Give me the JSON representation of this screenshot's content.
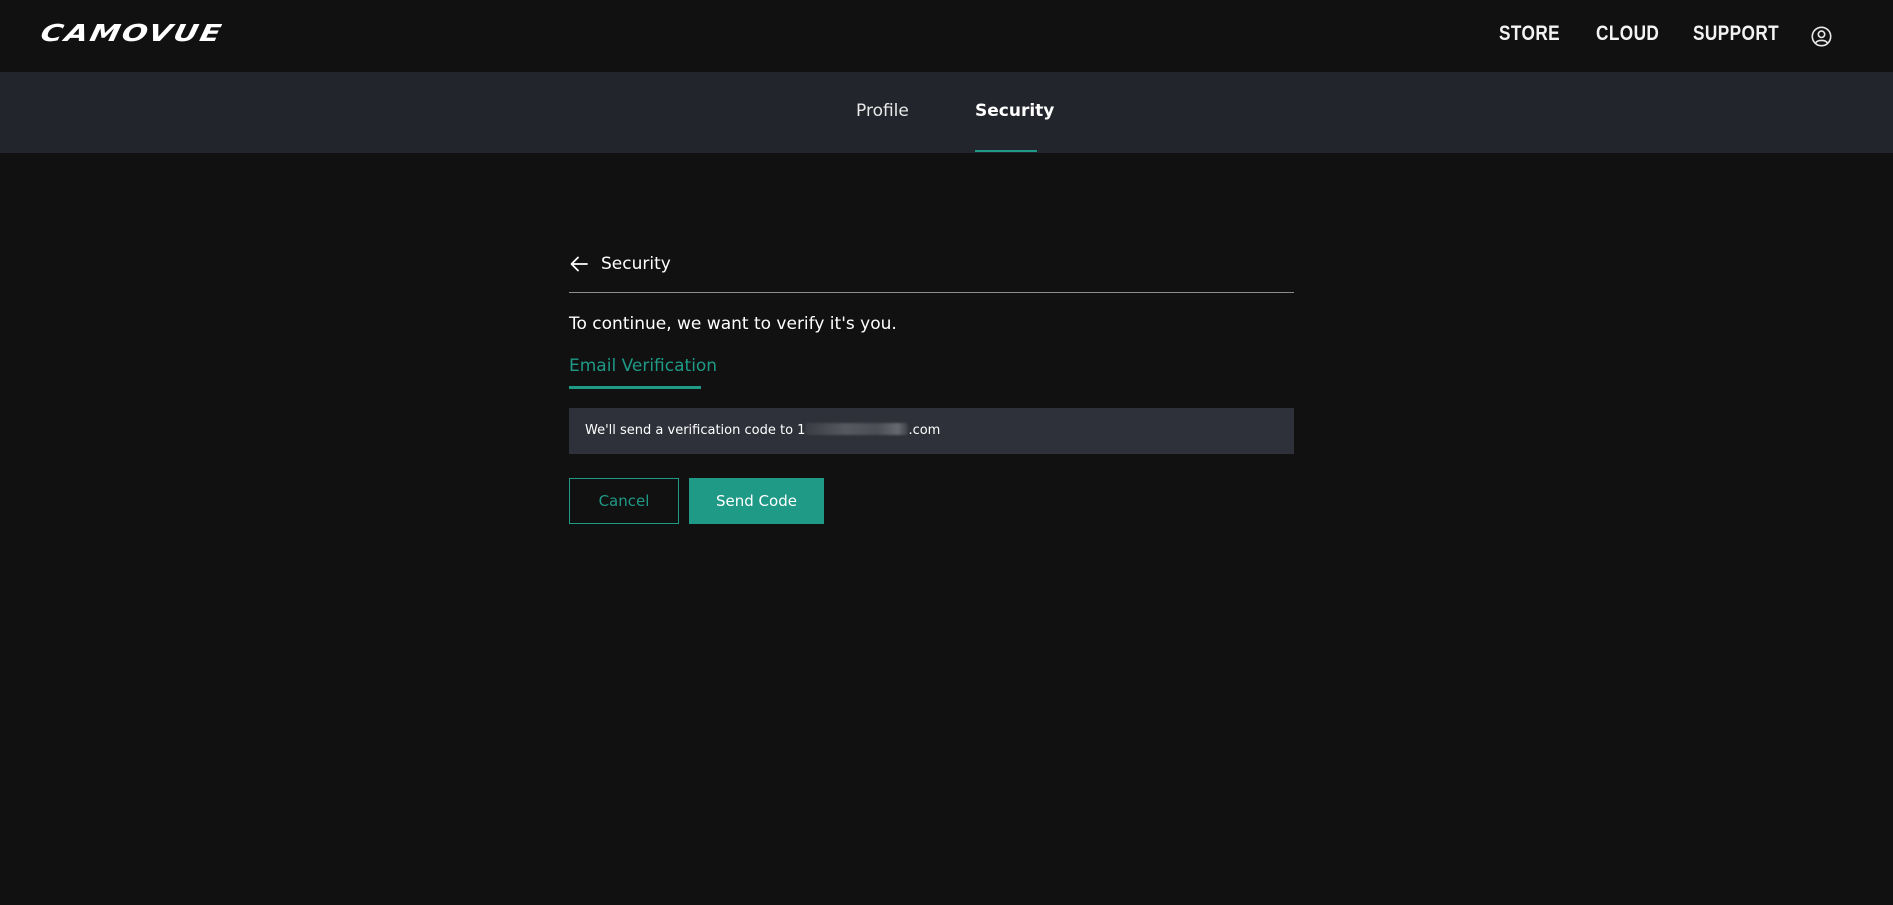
{
  "header": {
    "logo_text": "CAMOVUE",
    "nav": {
      "store": "STORE",
      "cloud": "CLOUD",
      "support": "SUPPORT"
    },
    "user_icon": "user-circle-icon"
  },
  "tabs": {
    "profile": "Profile",
    "security": "Security",
    "active": "Security"
  },
  "page": {
    "back_icon": "arrow-left-icon",
    "title": "Security",
    "prompt": "To continue, we want to verify it's you.",
    "method_tab": "Email Verification",
    "info_prefix": "We'll send a verification code to 1",
    "info_suffix": ".com",
    "cancel_label": "Cancel",
    "send_label": "Send Code"
  },
  "colors": {
    "accent": "#1e9a86",
    "background": "#111112",
    "tabbar": "#22252b",
    "info_box": "#2e3139"
  }
}
